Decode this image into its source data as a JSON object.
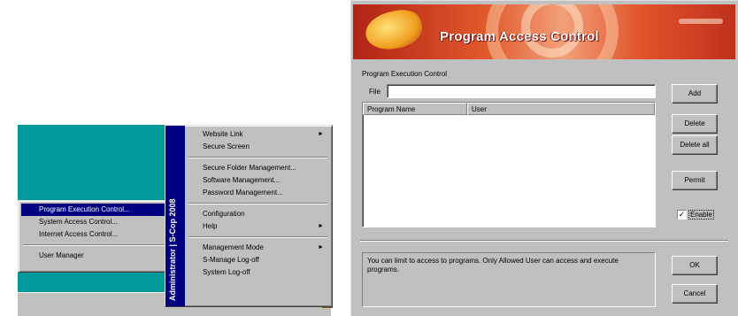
{
  "submenu": {
    "items": [
      {
        "label": "Program Execution Control..."
      },
      {
        "label": "System Access Control..."
      },
      {
        "label": "Internet Access Control..."
      },
      {
        "label": "User Manager"
      }
    ]
  },
  "main_menu": {
    "brand": "Administrator | S-Cop 2008",
    "items": [
      {
        "label": "Website Link"
      },
      {
        "label": "Secure Screen"
      },
      {
        "label": "Secure Folder Management..."
      },
      {
        "label": "Software Management..."
      },
      {
        "label": "Password Management..."
      },
      {
        "label": "Configuration"
      },
      {
        "label": "Help"
      },
      {
        "label": "Management Mode"
      },
      {
        "label": "S-Manage Log-off"
      },
      {
        "label": "System Log-off"
      }
    ]
  },
  "dialog": {
    "banner_title": "Program Access Control",
    "group_label": "Program Execution Control",
    "file_label": "File",
    "file_value": "",
    "columns": [
      "Program Name",
      "User"
    ],
    "buttons": {
      "add": "Add",
      "delete": "Delete",
      "delete_all": "Delete all",
      "permit": "Permit",
      "ok": "OK",
      "cancel": "Cancel"
    },
    "enable_label": "Enable",
    "enable_checked": true,
    "check_mark": "✓",
    "info_text": "You can limit to access to programs. Only Allowed User can access and execute programs."
  },
  "colors": {
    "desktop": "#009a9a",
    "menu_highlight": "#000080",
    "brand_bar": "#000080",
    "banner_red": "#c0301c"
  },
  "icons": {
    "arrow": "►"
  }
}
